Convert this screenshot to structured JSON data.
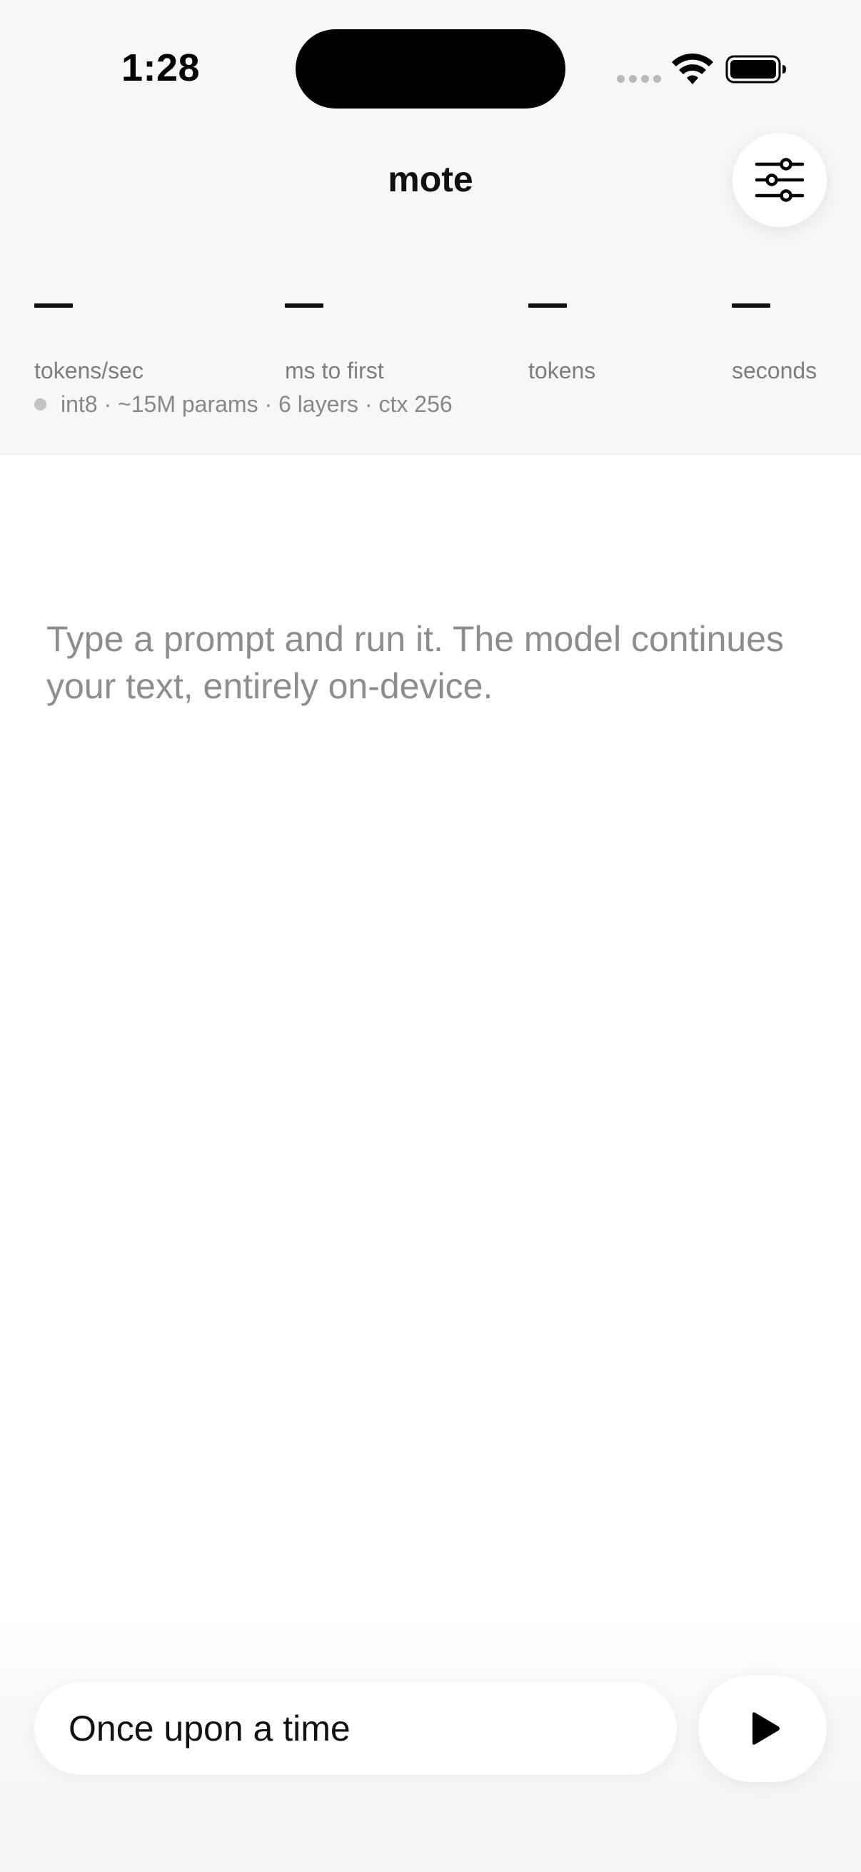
{
  "status_bar": {
    "time": "1:28"
  },
  "header": {
    "title": "mote",
    "settings_icon": "sliders-icon"
  },
  "stats": [
    {
      "value": "—",
      "label": "tokens/sec"
    },
    {
      "value": "—",
      "label": "ms to first"
    },
    {
      "value": "—",
      "label": "tokens"
    },
    {
      "value": "—",
      "label": "seconds"
    }
  ],
  "model_info": "int8 · ~15M params · 6 layers · ctx 256",
  "output": {
    "placeholder": "Type a prompt and run it. The model continues your text, entirely on-device."
  },
  "composer": {
    "prompt_value": "Once upon a time",
    "run_icon": "play-icon"
  },
  "colors": {
    "header_bg": "#f7f7f7",
    "text_primary": "#111111",
    "text_secondary": "#7e7e7e",
    "status_dot": "#c3c3c3"
  }
}
